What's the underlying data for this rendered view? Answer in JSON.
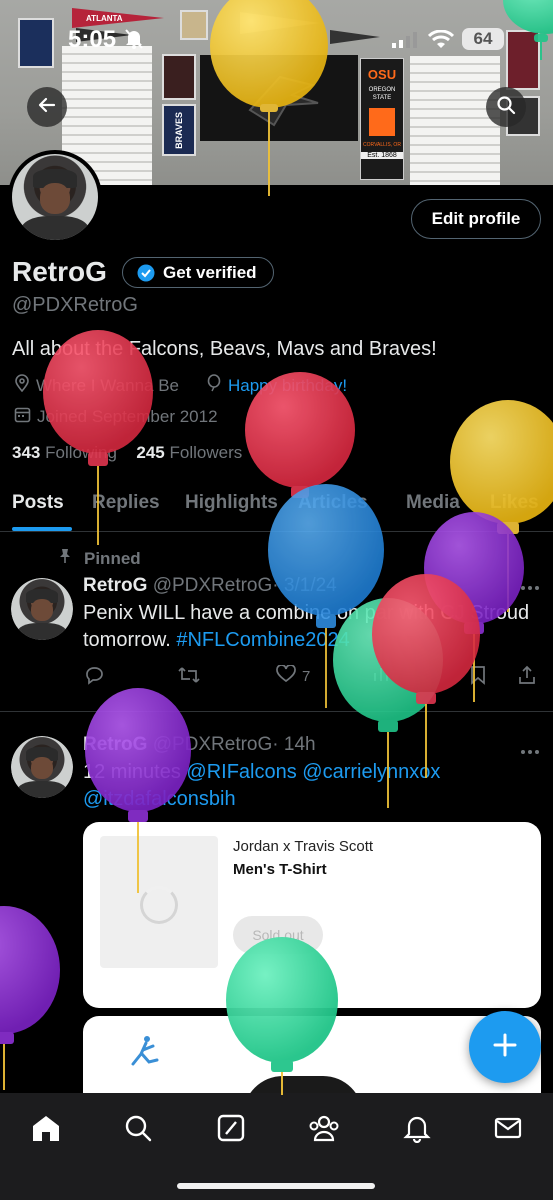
{
  "status_bar": {
    "time": "5:05",
    "battery": "64"
  },
  "profile": {
    "display_name": "RetroG",
    "verify_label": "Get verified",
    "handle": "@PDXRetroG",
    "edit_label": "Edit profile",
    "bio": "All about the Falcons, Beavs, Mavs and Braves!",
    "location": "Where I Wanna Be",
    "birthday": "Happy birthday!",
    "joined": "Joined September 2012",
    "following_count": "343",
    "following_label": "Following",
    "followers_count": "245",
    "followers_label": "Followers"
  },
  "banner": {
    "pennant_left_top": "ATLANTA",
    "poster_left": "BRAVES",
    "pennant_right": "OSU",
    "pennant_right_sub": "OREGON STATE",
    "pennant_right_foot": "CORVALLIS, OR",
    "pennant_right_year": "Est. 1868"
  },
  "tabs": [
    {
      "label": "Posts",
      "active": true
    },
    {
      "label": "Replies",
      "active": false
    },
    {
      "label": "Highlights",
      "active": false
    },
    {
      "label": "Articles",
      "active": false
    },
    {
      "label": "Media",
      "active": false
    },
    {
      "label": "Likes",
      "active": false
    }
  ],
  "posts": [
    {
      "pinned_label": "Pinned",
      "name": "RetroG",
      "handle": "@PDXRetroG",
      "time": "· 3/1/24",
      "text_line1": "Penix WILL have a combine on par with CJ Stroud",
      "text_line2_plain": "tomorrow. ",
      "text_line2_tag": "#NFLCombine2024",
      "likes": "7"
    },
    {
      "name": "RetroG",
      "handle": "@PDXRetroG",
      "time": "· 14h",
      "text_plain": "12 minutes ",
      "mention1": "@RIFalcons",
      "mention2": "@carrielynnxox",
      "mention3": "@itzdafalconsbih",
      "card": {
        "brand": "Jordan x Travis Scott",
        "title": "Men's T-Shirt",
        "button": "Sold out"
      }
    }
  ],
  "colors": {
    "accent": "#1d9bf0",
    "background": "#000000",
    "muted": "#71767b",
    "divider": "#2f3336",
    "balloon_yellow": "#f2c21b",
    "balloon_red": "#e0364f",
    "balloon_blue": "#2f8fe3",
    "balloon_purple": "#8a2fd1",
    "balloon_green": "#2ed59a"
  },
  "icons": {
    "back": "arrow-left-icon",
    "search": "search-icon",
    "location": "location-pin-icon",
    "birthday": "balloon-icon",
    "calendar": "calendar-icon",
    "pin": "pin-icon",
    "reply": "reply-icon",
    "repost": "repost-icon",
    "like": "heart-icon",
    "views": "views-icon",
    "bookmark": "bookmark-icon",
    "share": "share-icon",
    "compose": "plus-icon",
    "nav": [
      "home-icon",
      "search-icon",
      "grok-icon",
      "communities-icon",
      "bell-icon",
      "mail-icon"
    ]
  }
}
